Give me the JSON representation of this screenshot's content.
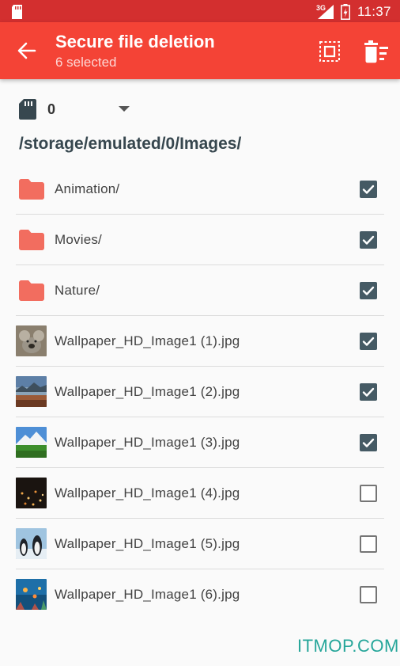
{
  "statusbar": {
    "network": "3G",
    "time": "11:37"
  },
  "appbar": {
    "title": "Secure file deletion",
    "subtitle": "6 selected"
  },
  "storage": {
    "value": "0"
  },
  "path": "/storage/emulated/0/Images/",
  "items": [
    {
      "label": "Animation/",
      "kind": "folder",
      "checked": true
    },
    {
      "label": "Movies/",
      "kind": "folder",
      "checked": true
    },
    {
      "label": "Nature/",
      "kind": "folder",
      "checked": true
    },
    {
      "label": "Wallpaper_HD_Image1 (1).jpg",
      "kind": "image",
      "checked": true
    },
    {
      "label": "Wallpaper_HD_Image1 (2).jpg",
      "kind": "image",
      "checked": true
    },
    {
      "label": "Wallpaper_HD_Image1 (3).jpg",
      "kind": "image",
      "checked": true
    },
    {
      "label": "Wallpaper_HD_Image1 (4).jpg",
      "kind": "image",
      "checked": false
    },
    {
      "label": "Wallpaper_HD_Image1 (5).jpg",
      "kind": "image",
      "checked": false
    },
    {
      "label": "Wallpaper_HD_Image1 (6).jpg",
      "kind": "image",
      "checked": false
    }
  ],
  "watermark": "ITMOP.COM",
  "colors": {
    "statusbar": "#d32f2f",
    "appbar": "#f44336",
    "folder": "#f26d5f",
    "checkbox": "#455a64",
    "path": "#37474f"
  }
}
